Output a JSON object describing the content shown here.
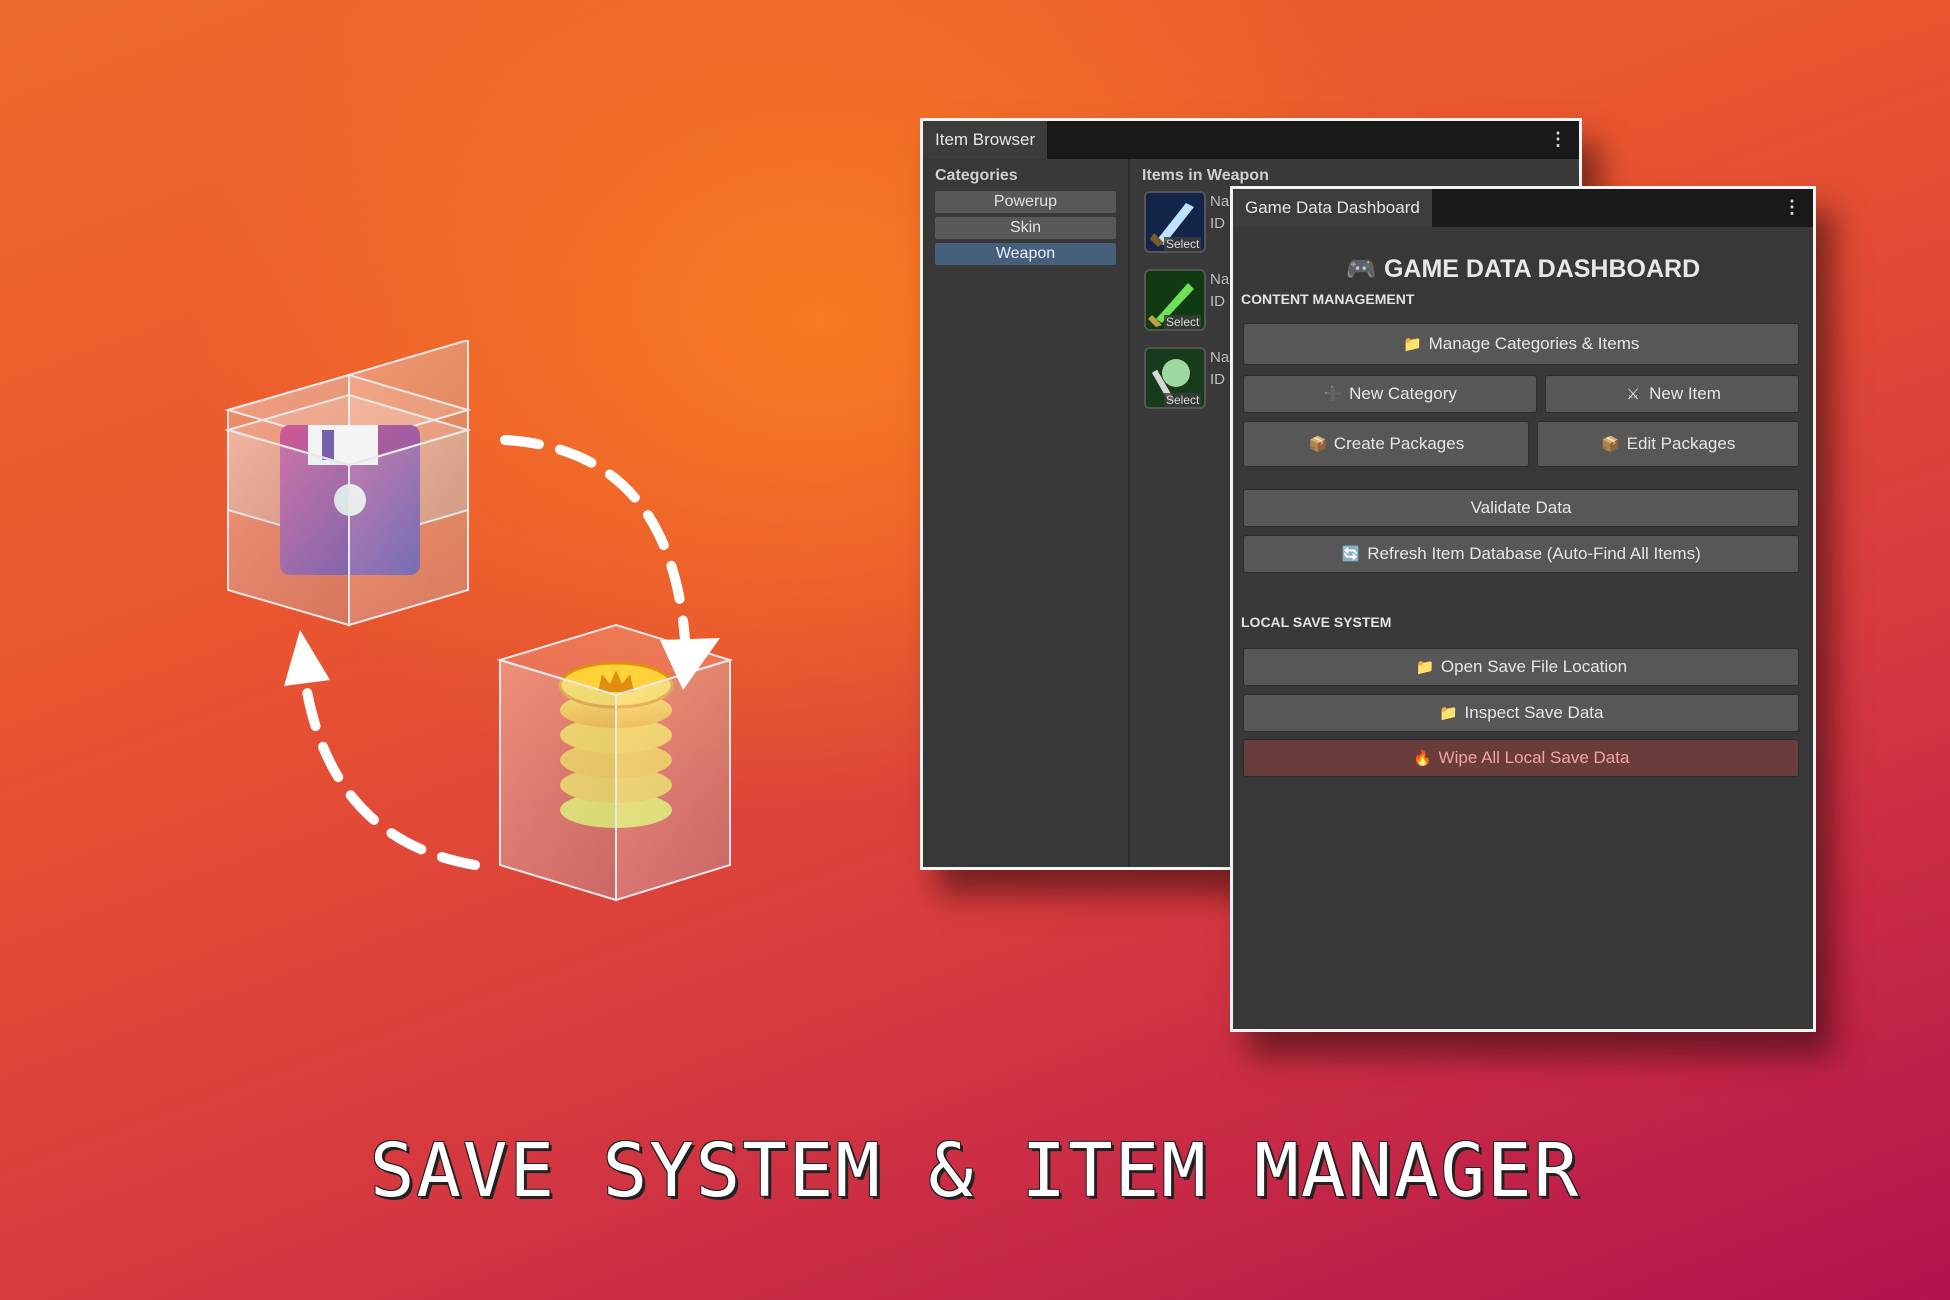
{
  "headline": "SAVE SYSTEM & ITEM MANAGER",
  "item_browser": {
    "tab_title": "Item Browser",
    "categories_heading": "Categories",
    "categories": [
      "Powerup",
      "Skin",
      "Weapon"
    ],
    "selected_category": "Weapon",
    "items_heading": "Items in Weapon",
    "items": [
      {
        "select_label": "Select",
        "name_prefix": "Na",
        "id_prefix": "ID"
      },
      {
        "select_label": "Select",
        "name_prefix": "Na",
        "id_prefix": "ID"
      },
      {
        "select_label": "Select",
        "name_prefix": "Na",
        "id_prefix": "ID"
      }
    ],
    "menu_icon": "kebab-icon"
  },
  "dashboard": {
    "tab_title": "Game Data Dashboard",
    "title": "GAME DATA DASHBOARD",
    "title_icon": "gamepad-icon",
    "content_section": "CONTENT MANAGEMENT",
    "buttons": {
      "manage": "Manage Categories & Items",
      "new_category": "New Category",
      "new_item": "New Item",
      "create_packages": "Create Packages",
      "edit_packages": "Edit Packages",
      "validate": "Validate Data",
      "refresh": "Refresh Item Database (Auto-Find All Items)",
      "open_save": "Open Save File Location",
      "inspect_save": "Inspect Save Data",
      "wipe": "Wipe All Local Save Data"
    },
    "save_section": "LOCAL SAVE SYSTEM",
    "colors": {
      "danger_text": "#f3a3a3",
      "danger_bg": "#6a3d3d",
      "selected_category": "#46607c"
    }
  }
}
